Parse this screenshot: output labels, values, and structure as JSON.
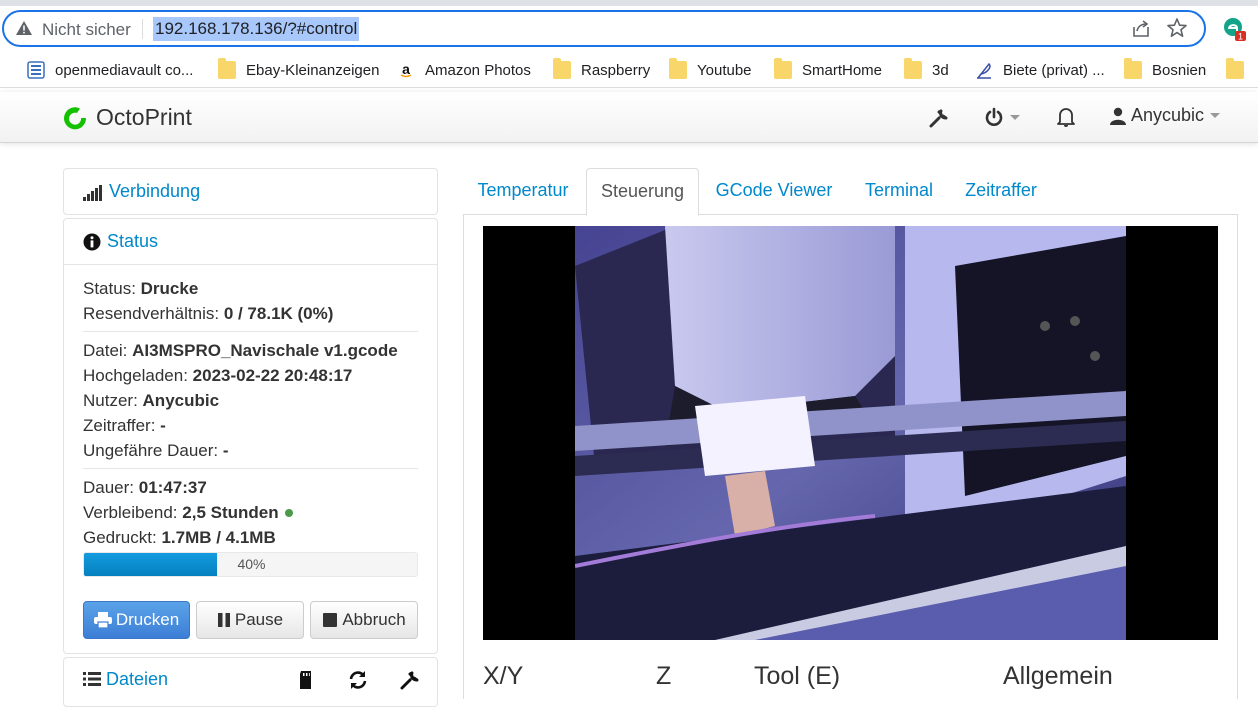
{
  "browser": {
    "security_label": "Nicht sicher",
    "url": "192.168.178.136/?#control",
    "extension_badge": "1"
  },
  "bookmarks": [
    {
      "label": "openmediavault co...",
      "icon": "omv-icon"
    },
    {
      "label": "Ebay-Kleinanzeigen",
      "icon": "folder-icon"
    },
    {
      "label": "Amazon Photos",
      "icon": "amazon-icon"
    },
    {
      "label": "Raspberry",
      "icon": "folder-icon"
    },
    {
      "label": "Youtube",
      "icon": "folder-icon"
    },
    {
      "label": "SmartHome",
      "icon": "folder-icon"
    },
    {
      "label": "3d",
      "icon": "folder-icon"
    },
    {
      "label": "Biete (privat) ...",
      "icon": "feather-icon"
    },
    {
      "label": "Bosnien",
      "icon": "folder-icon"
    }
  ],
  "navbar": {
    "brand": "OctoPrint",
    "user": "Anycubic",
    "accent": "#0088cc"
  },
  "sidebar": {
    "connection": "Verbindung",
    "status_title": "Status",
    "status": {
      "status_label": "Status:",
      "status_value": "Drucke",
      "resend_label": "Resendverhältnis:",
      "resend_value": "0 / 78.1K (0%)",
      "file_label": "Datei:",
      "file_value": "AI3MSPRO_Navischale v1.gcode",
      "uploaded_label": "Hochgeladen:",
      "uploaded_value": "2023-02-22 20:48:17",
      "user_label": "Nutzer:",
      "user_value": "Anycubic",
      "timelapse_label": "Zeitraffer:",
      "timelapse_value": "-",
      "est_label": "Ungefähre Dauer:",
      "est_value": "-",
      "duration_label": "Dauer:",
      "duration_value": "01:47:37",
      "remaining_label": "Verbleibend:",
      "remaining_value": "2,5 Stunden",
      "printed_label": "Gedruckt:",
      "printed_value": "1.7MB / 4.1MB",
      "progress_percent": 40,
      "progress_text": "40%"
    },
    "buttons": {
      "print": "Drucken",
      "pause": "Pause",
      "cancel": "Abbruch"
    },
    "files_title": "Dateien"
  },
  "tabs": [
    "Temperatur",
    "Steuerung",
    "GCode Viewer",
    "Terminal",
    "Zeitraffer"
  ],
  "active_tab": "Steuerung",
  "control_sections": [
    "X/Y",
    "Z",
    "Tool (E)",
    "Allgemein"
  ]
}
